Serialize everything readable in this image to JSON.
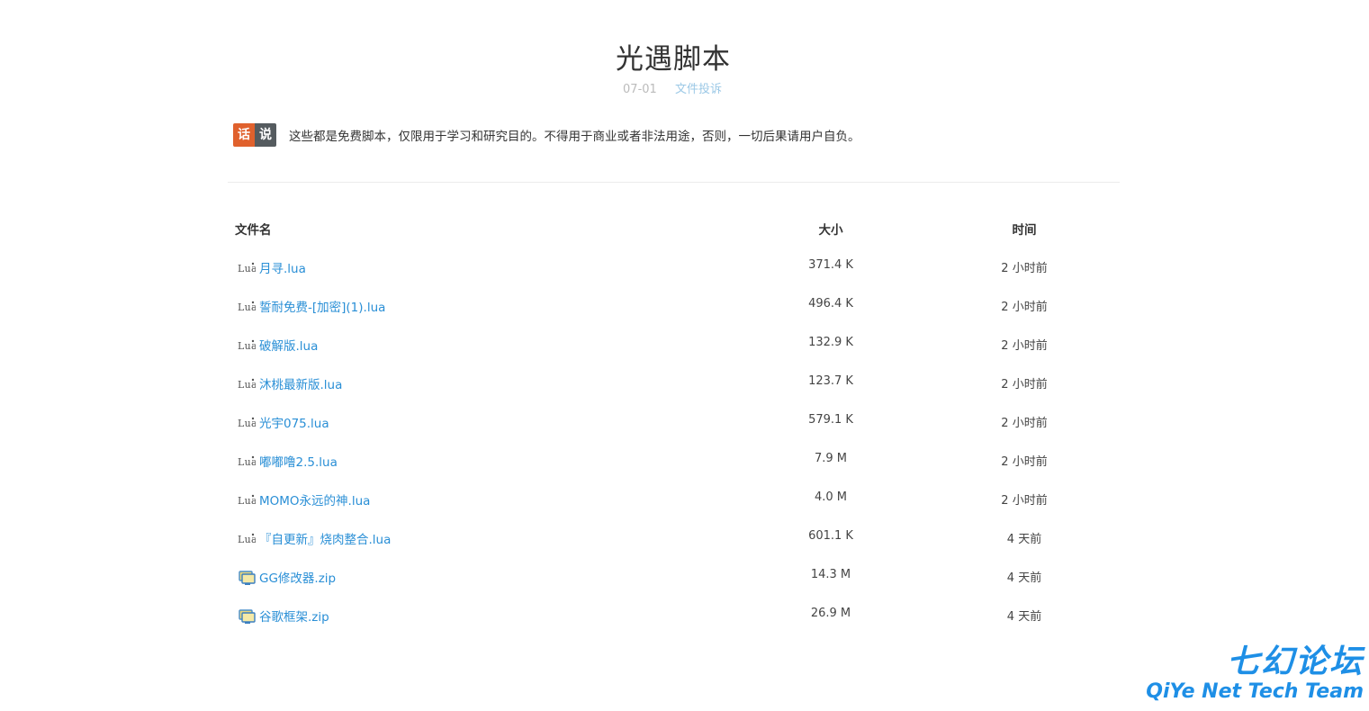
{
  "page": {
    "title": "光遇脚本",
    "date": "07-01",
    "report_link": "文件投诉"
  },
  "notice": {
    "badge_left": "话",
    "badge_right": "说",
    "text": "这些都是免费脚本，仅限用于学习和研究目的。不得用于商业或者非法用途，否则，一切后果请用户自负。"
  },
  "table": {
    "headers": {
      "name": "文件名",
      "size": "大小",
      "time": "时间"
    },
    "rows": [
      {
        "icon": "lua-file-icon",
        "name": "月寻.lua",
        "size": "371.4 K",
        "time": "2 小时前"
      },
      {
        "icon": "lua-file-icon",
        "name": "誓耐免费-[加密](1).lua",
        "size": "496.4 K",
        "time": "2 小时前"
      },
      {
        "icon": "lua-file-icon",
        "name": "破解版.lua",
        "size": "132.9 K",
        "time": "2 小时前"
      },
      {
        "icon": "lua-file-icon",
        "name": "沐桃最新版.lua",
        "size": "123.7 K",
        "time": "2 小时前"
      },
      {
        "icon": "lua-file-icon",
        "name": "光宇075.lua",
        "size": "579.1 K",
        "time": "2 小时前"
      },
      {
        "icon": "lua-file-icon",
        "name": "嘟嘟噜2.5.lua",
        "size": "7.9 M",
        "time": "2 小时前"
      },
      {
        "icon": "lua-file-icon",
        "name": "MOMO永远的神.lua",
        "size": "4.0 M",
        "time": "2 小时前"
      },
      {
        "icon": "lua-file-icon",
        "name": "『自更新』烧肉整合.lua",
        "size": "601.1 K",
        "time": "4 天前"
      },
      {
        "icon": "zip-file-icon",
        "name": "GG修改器.zip",
        "size": "14.3 M",
        "time": "4 天前"
      },
      {
        "icon": "zip-file-icon",
        "name": "谷歌框架.zip",
        "size": "26.9 M",
        "time": "4 天前"
      }
    ]
  },
  "watermark": {
    "cn": "七幻论坛",
    "en": "QiYe Net Tech Team"
  },
  "icons": {
    "lua_label": "Lua"
  },
  "colors": {
    "link": "#2a8fd6",
    "badge_left": "#e0612d",
    "badge_right": "#555b5f",
    "watermark": "#1e8fe6"
  }
}
